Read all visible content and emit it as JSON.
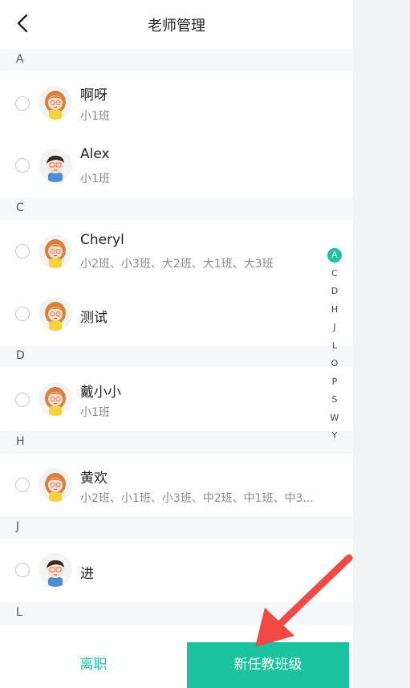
{
  "header": {
    "title": "老师管理"
  },
  "sections": {
    "a": "A",
    "c": "C",
    "d": "D",
    "h": "H",
    "j": "J",
    "l": "L"
  },
  "teachers": [
    {
      "name": "啊呀",
      "classes": "小1班",
      "avatar": "female-teacher-icon"
    },
    {
      "name": "Alex",
      "classes": "小1班",
      "avatar": "male-teacher-icon"
    },
    {
      "name": "Cheryl",
      "classes": "小2班、小3班、大2班、大1班、大3班",
      "avatar": "female-teacher-icon"
    },
    {
      "name": "测试",
      "classes": "",
      "avatar": "female-teacher-icon"
    },
    {
      "name": "戴小小",
      "classes": "小1班",
      "avatar": "female-teacher-icon"
    },
    {
      "name": "黄欢",
      "classes": "小2班、小1班、小3班、中2班、中1班、中3...",
      "avatar": "female-teacher-icon"
    },
    {
      "name": "进",
      "classes": "",
      "avatar": "male-teacher-icon"
    }
  ],
  "index": [
    "A",
    "C",
    "D",
    "H",
    "J",
    "L",
    "O",
    "P",
    "S",
    "W",
    "Y"
  ],
  "bottom": {
    "leave_label": "离职",
    "new_label": "新任教班级"
  },
  "colors": {
    "accent": "#1bc49e",
    "arrow": "#f04a47"
  }
}
